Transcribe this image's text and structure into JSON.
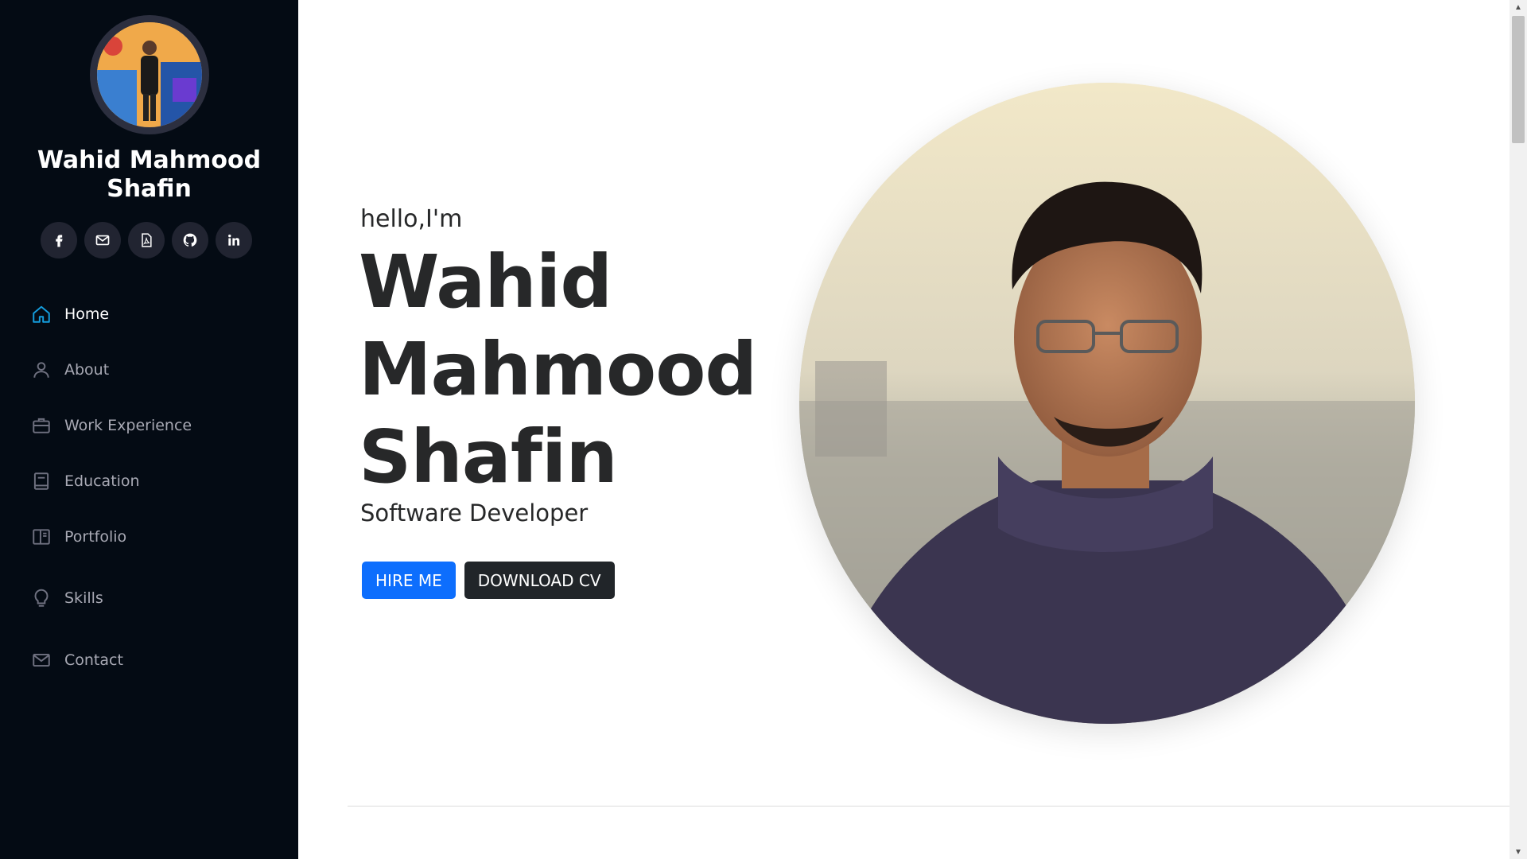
{
  "profile": {
    "name": "Wahid Mahmood Shafin"
  },
  "social": [
    {
      "icon": "facebook-icon"
    },
    {
      "icon": "mail-icon"
    },
    {
      "icon": "pdf-icon"
    },
    {
      "icon": "github-icon"
    },
    {
      "icon": "linkedin-icon"
    }
  ],
  "nav": {
    "items": [
      {
        "label": "Home",
        "icon": "home-icon",
        "active": true
      },
      {
        "label": "About",
        "icon": "person-icon",
        "active": false
      },
      {
        "label": "Work Experience",
        "icon": "briefcase-icon",
        "active": false
      },
      {
        "label": "Education",
        "icon": "book-icon",
        "active": false
      },
      {
        "label": "Portfolio",
        "icon": "portfolio-icon",
        "active": false
      },
      {
        "label": "Skills",
        "icon": "lightbulb-icon",
        "active": false
      },
      {
        "label": "Contact",
        "icon": "envelope-icon",
        "active": false
      }
    ]
  },
  "hero": {
    "greeting": "hello,I'm",
    "name_line1": "Wahid",
    "name_line2": "Mahmood",
    "name_line3": "Shafin",
    "role": "Software Developer",
    "hire_label": "HIRE ME",
    "cv_label": "DOWNLOAD CV"
  },
  "colors": {
    "sidebar_bg": "#040b14",
    "accent": "#149ddd",
    "primary_button": "#0d6efd",
    "dark_button": "#212529"
  }
}
